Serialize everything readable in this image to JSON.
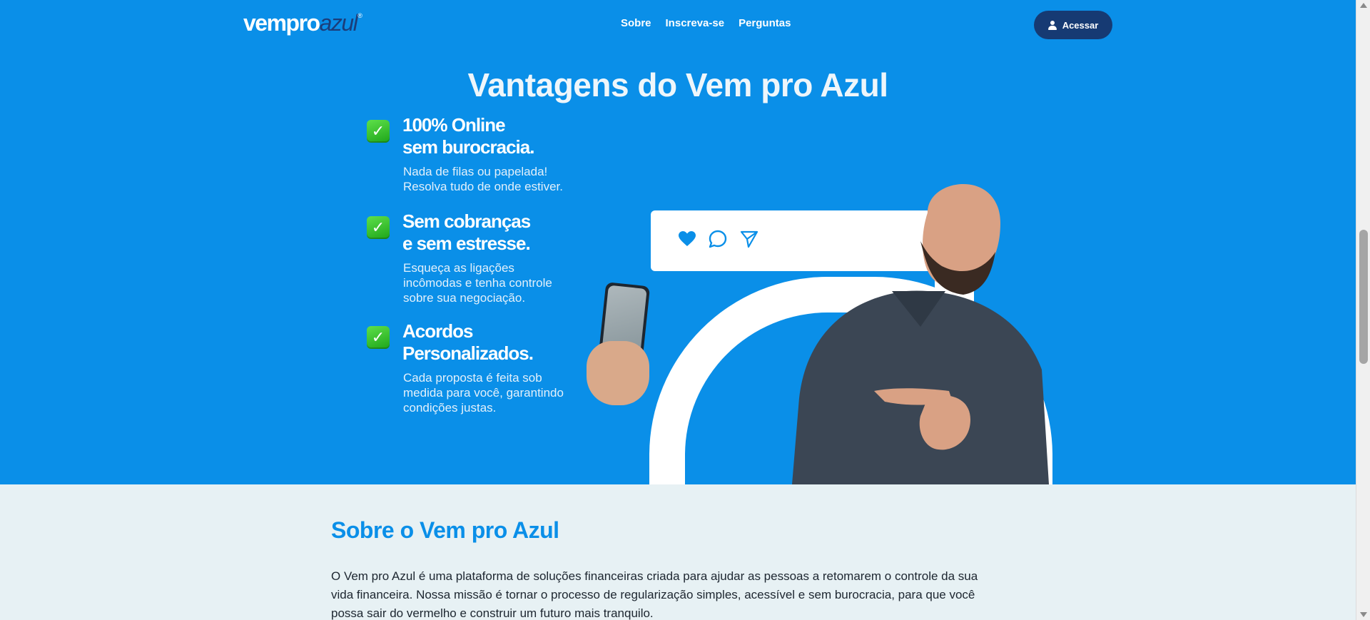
{
  "header": {
    "logo_primary": "vempro",
    "logo_secondary": "azul",
    "logo_mark": "®",
    "nav": [
      "Sobre",
      "Inscreva-se",
      "Perguntas"
    ],
    "login_label": "Acessar",
    "login_icon": "user-icon"
  },
  "hero": {
    "title": "Vantagens do Vem pro Azul",
    "benefits": [
      {
        "icon": "check-icon",
        "title_line1": "100% Online",
        "title_line2": "sem burocracia.",
        "text_line1": "Nada de filas ou papelada!",
        "text_line2": "Resolva tudo de onde estiver.",
        "text_line3": ""
      },
      {
        "icon": "check-icon",
        "title_line1": "Sem cobranças",
        "title_line2": "e sem estresse.",
        "text_line1": "Esqueça as ligações",
        "text_line2": "incômodas e tenha controle",
        "text_line3": "sobre sua negociação."
      },
      {
        "icon": "check-icon",
        "title_line1": "Acordos",
        "title_line2": "Personalizados.",
        "text_line1": "Cada proposta é feita sob",
        "text_line2": "medida para você, garantindo",
        "text_line3": "condições justas."
      }
    ],
    "post_icons": [
      "heart-icon",
      "comment-icon",
      "send-icon"
    ]
  },
  "about": {
    "title": "Sobre o Vem pro Azul",
    "text_line1": "O Vem pro Azul é uma plataforma de soluções financeiras criada para ajudar as pessoas a retomarem o controle da sua",
    "text_line2": "vida financeira. Nossa missão é tornar o processo de regularização simples, acessível e sem burocracia, para que você",
    "text_line3": "possa sair do vermelho e construir um futuro mais tranquilo."
  },
  "colors": {
    "brand_blue": "#0a8fe8",
    "dark_navy": "#163a73",
    "check_green": "#1ea51a",
    "section_bg": "#e7f1f4"
  }
}
